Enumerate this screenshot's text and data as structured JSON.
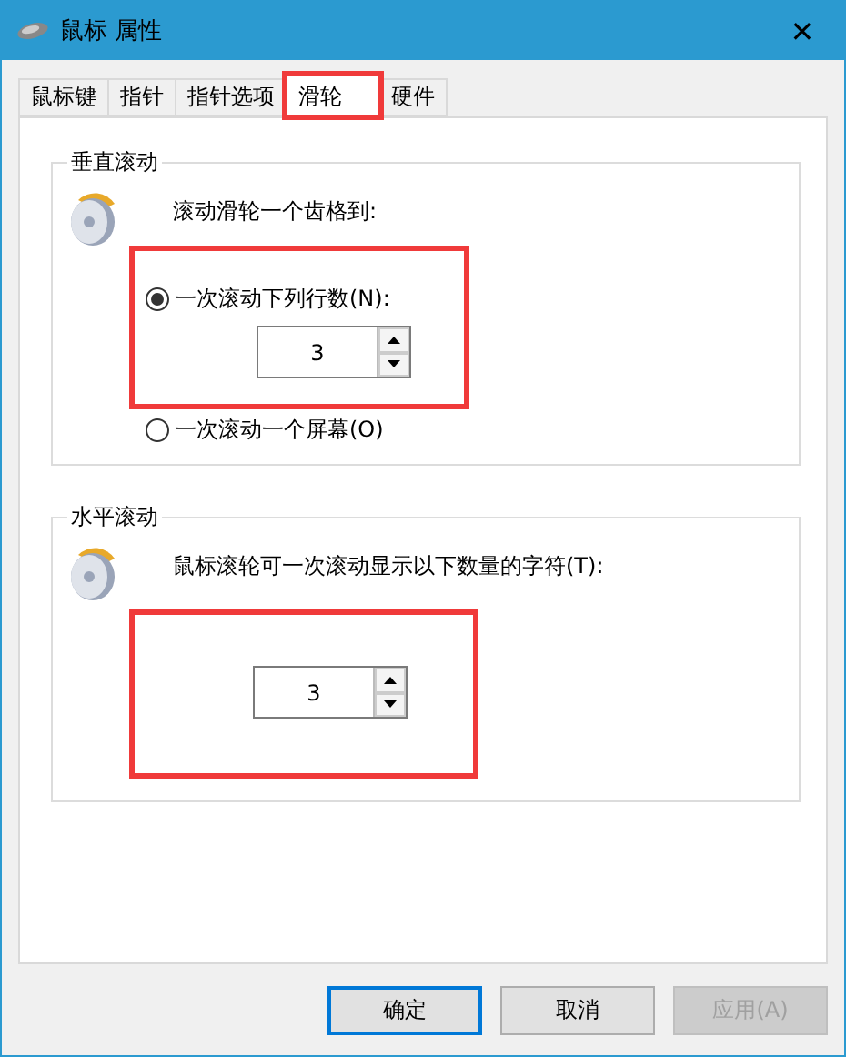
{
  "window": {
    "title": "鼠标 属性",
    "close": "✕"
  },
  "tabs": [
    {
      "label": "鼠标键",
      "selected": false,
      "highlighted": false
    },
    {
      "label": "指针",
      "selected": false,
      "highlighted": false
    },
    {
      "label": "指针选项",
      "selected": false,
      "highlighted": false
    },
    {
      "label": "滑轮",
      "selected": true,
      "highlighted": true
    },
    {
      "label": "硬件",
      "selected": false,
      "highlighted": false
    }
  ],
  "vertical": {
    "title": "垂直滚动",
    "prompt": "滚动滑轮一个齿格到:",
    "highlighted": true,
    "options": [
      {
        "label": "一次滚动下列行数(N):",
        "selected": true
      },
      {
        "label": "一次滚动一个屏幕(O)",
        "selected": false
      }
    ],
    "spinner": {
      "value": "3"
    }
  },
  "horizontal": {
    "title": "水平滚动",
    "prompt": "鼠标滚轮可一次滚动显示以下数量的字符(T):",
    "highlighted": true,
    "spinner": {
      "value": "3"
    }
  },
  "buttons": [
    {
      "label": "确定",
      "default": true,
      "disabled": false
    },
    {
      "label": "取消",
      "default": false,
      "disabled": false
    },
    {
      "label": "应用(A)",
      "default": false,
      "disabled": true
    }
  ]
}
